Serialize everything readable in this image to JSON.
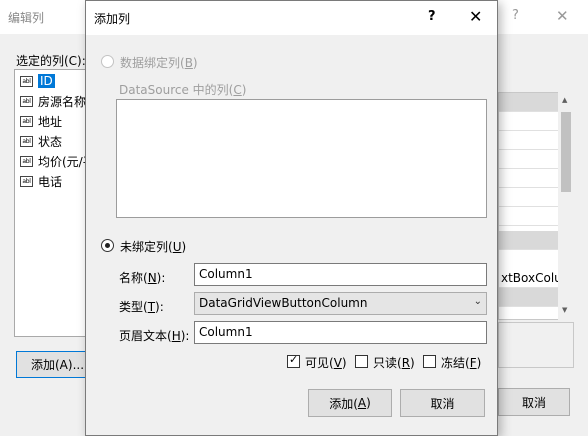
{
  "background_dialog": {
    "title": "编辑列",
    "help_glyph": "?",
    "close_glyph": "✕",
    "selected_columns_label": "选定的列(C):",
    "columns": [
      {
        "icon_text": "abl",
        "label": "ID",
        "selected": true
      },
      {
        "icon_text": "abl",
        "label": "房源名称"
      },
      {
        "icon_text": "abl",
        "label": "地址"
      },
      {
        "icon_text": "abl",
        "label": "状态"
      },
      {
        "icon_text": "abl",
        "label": "均价(元/平"
      },
      {
        "icon_text": "abl",
        "label": "电话"
      }
    ],
    "add_button": "添加(A)...",
    "property_fragment": "xtBoxColu",
    "cancel_button": "取消"
  },
  "dialog": {
    "title": "添加列",
    "help_glyph": "?",
    "close_glyph": "✕",
    "databound": {
      "label_main": "数据绑定列(",
      "label_key": "B",
      "label_end": ")",
      "selected": false,
      "enabled": false
    },
    "datasource": {
      "label_main": "DataSource 中的列(",
      "label_key": "C",
      "label_end": ")"
    },
    "unbound": {
      "label_main": "未绑定列(",
      "label_key": "U",
      "label_end": ")",
      "selected": true
    },
    "name": {
      "label_main": "名称(",
      "label_key": "N",
      "label_end": "):",
      "value": "Column1"
    },
    "type": {
      "label_main": "类型(",
      "label_key": "T",
      "label_end": "):",
      "value": "DataGridViewButtonColumn"
    },
    "header": {
      "label_main": "页眉文本(",
      "label_key": "H",
      "label_end": "):",
      "value": "Column1"
    },
    "checkboxes": {
      "visible": {
        "label_main": "可见(",
        "label_key": "V",
        "label_end": ")",
        "checked": true
      },
      "readonly": {
        "label_main": "只读(",
        "label_key": "R",
        "label_end": ")",
        "checked": false
      },
      "frozen": {
        "label_main": "冻结(",
        "label_key": "F",
        "label_end": ")",
        "checked": false
      }
    },
    "add_button": {
      "label_main": "添加(",
      "label_key": "A",
      "label_end": ")"
    },
    "cancel_button": "取消"
  }
}
